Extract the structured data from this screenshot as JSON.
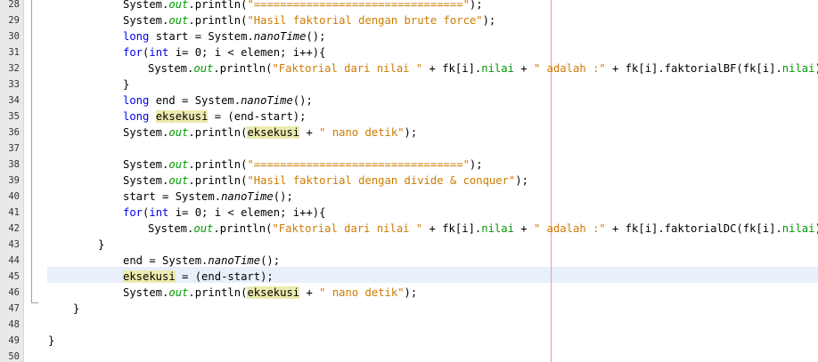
{
  "colors": {
    "keyword": "#0000e6",
    "string": "#ce7b00",
    "field": "#009900",
    "highlight": "#ecebb0",
    "current_line": "#e8f0fb",
    "margin_line": "#e8a0a0"
  },
  "editor": {
    "line_numbers": [
      "28",
      "29",
      "30",
      "31",
      "32",
      "33",
      "34",
      "35",
      "36",
      "37",
      "38",
      "39",
      "40",
      "41",
      "42",
      "43",
      "44",
      "45",
      "46",
      "47",
      "48",
      "49",
      "50"
    ],
    "lines": [
      {
        "indent": 0,
        "tokens": [
          [
            "System.",
            ""
          ],
          [
            "out",
            "fld"
          ],
          [
            ".println(",
            ""
          ],
          [
            "\"================================\"",
            "str"
          ],
          [
            ");",
            ""
          ]
        ]
      },
      {
        "indent": 0,
        "tokens": [
          [
            "System.",
            ""
          ],
          [
            "out",
            "fld"
          ],
          [
            ".println(",
            ""
          ],
          [
            "\"Hasil faktorial dengan brute force\"",
            "str"
          ],
          [
            ");",
            ""
          ]
        ]
      },
      {
        "indent": 0,
        "tokens": [
          [
            "long",
            "kw"
          ],
          [
            " start = System.",
            ""
          ],
          [
            "nanoTime",
            "mth"
          ],
          [
            "();",
            ""
          ]
        ]
      },
      {
        "indent": 0,
        "tokens": [
          [
            "for",
            "kw"
          ],
          [
            "(",
            ""
          ],
          [
            "int",
            "kw"
          ],
          [
            " i= 0; i < elemen; i++){",
            ""
          ]
        ]
      },
      {
        "indent": 1,
        "tokens": [
          [
            "System.",
            ""
          ],
          [
            "out",
            "fld"
          ],
          [
            ".println(",
            ""
          ],
          [
            "\"Faktorial dari nilai \"",
            "str"
          ],
          [
            " + fk[i].",
            ""
          ],
          [
            "nilai",
            "fldn"
          ],
          [
            " + ",
            ""
          ],
          [
            "\" adalah :\"",
            "str"
          ],
          [
            " + fk[i].faktorialBF(fk[i].",
            ""
          ],
          [
            "nilai",
            "fldn"
          ],
          [
            "));",
            ""
          ]
        ]
      },
      {
        "indent": 0,
        "tokens": [
          [
            "}",
            ""
          ]
        ]
      },
      {
        "indent": 0,
        "tokens": [
          [
            "long",
            "kw"
          ],
          [
            " end = System.",
            ""
          ],
          [
            "nanoTime",
            "mth"
          ],
          [
            "();",
            ""
          ]
        ]
      },
      {
        "indent": 0,
        "tokens": [
          [
            "long",
            "kw"
          ],
          [
            " ",
            ""
          ],
          [
            "eksekusi",
            "hl"
          ],
          [
            " = (end-start);",
            ""
          ]
        ]
      },
      {
        "indent": 0,
        "tokens": [
          [
            "System.",
            ""
          ],
          [
            "out",
            "fld"
          ],
          [
            ".println(",
            ""
          ],
          [
            "eksekusi",
            "hl"
          ],
          [
            " + ",
            ""
          ],
          [
            "\" nano detik\"",
            "str"
          ],
          [
            ");",
            ""
          ]
        ]
      },
      {
        "indent": 0,
        "tokens": []
      },
      {
        "indent": 0,
        "tokens": [
          [
            "System.",
            ""
          ],
          [
            "out",
            "fld"
          ],
          [
            ".println(",
            ""
          ],
          [
            "\"================================\"",
            "str"
          ],
          [
            ");",
            ""
          ]
        ]
      },
      {
        "indent": 0,
        "tokens": [
          [
            "System.",
            ""
          ],
          [
            "out",
            "fld"
          ],
          [
            ".println(",
            ""
          ],
          [
            "\"Hasil faktorial dengan divide & conquer\"",
            "str"
          ],
          [
            ");",
            ""
          ]
        ]
      },
      {
        "indent": 0,
        "tokens": [
          [
            "start = System.",
            ""
          ],
          [
            "nanoTime",
            "mth"
          ],
          [
            "();",
            ""
          ]
        ]
      },
      {
        "indent": 0,
        "tokens": [
          [
            "for",
            "kw"
          ],
          [
            "(",
            ""
          ],
          [
            "int",
            "kw"
          ],
          [
            " i= 0; i < elemen; i++){",
            ""
          ]
        ]
      },
      {
        "indent": 1,
        "tokens": [
          [
            "System.",
            ""
          ],
          [
            "out",
            "fld"
          ],
          [
            ".println(",
            ""
          ],
          [
            "\"Faktorial dari nilai \"",
            "str"
          ],
          [
            " + fk[i].",
            ""
          ],
          [
            "nilai",
            "fldn"
          ],
          [
            " + ",
            ""
          ],
          [
            "\" adalah :\"",
            "str"
          ],
          [
            " + fk[i].faktorialDC(fk[i].",
            ""
          ],
          [
            "nilai",
            "fldn"
          ],
          [
            "));",
            ""
          ]
        ]
      },
      {
        "indent": -1,
        "tokens": [
          [
            "}",
            ""
          ]
        ]
      },
      {
        "indent": 0,
        "tokens": [
          [
            "end = System.",
            ""
          ],
          [
            "nanoTime",
            "mth"
          ],
          [
            "();",
            ""
          ]
        ]
      },
      {
        "indent": 0,
        "tokens": [
          [
            "eksekusi",
            "hl"
          ],
          [
            " = (end-start);",
            ""
          ]
        ]
      },
      {
        "indent": 0,
        "tokens": [
          [
            "System.",
            ""
          ],
          [
            "out",
            "fld"
          ],
          [
            ".println(",
            ""
          ],
          [
            "eksekusi",
            "hl"
          ],
          [
            " + ",
            ""
          ],
          [
            "\" nano detik\"",
            "str"
          ],
          [
            ");",
            ""
          ]
        ]
      },
      {
        "indent": -2,
        "tokens": [
          [
            "}",
            ""
          ]
        ]
      },
      {
        "indent": 0,
        "tokens": []
      },
      {
        "indent": -3,
        "tokens": [
          [
            "}",
            ""
          ]
        ]
      },
      {
        "indent": 0,
        "tokens": []
      }
    ]
  }
}
